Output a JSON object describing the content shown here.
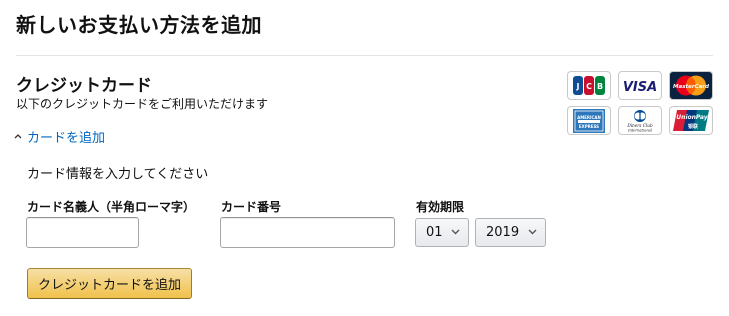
{
  "page": {
    "title": "新しいお支払い方法を追加"
  },
  "credit_card": {
    "title": "クレジットカード",
    "subtitle": "以下のクレジットカードをご利用いただけます",
    "add_link": "カードを追加",
    "brands": [
      {
        "name": "JCB",
        "icon": "jcb-icon",
        "color": "#0e4c96"
      },
      {
        "name": "VISA",
        "icon": "visa-icon",
        "color": "#1a1f71"
      },
      {
        "name": "MasterCard",
        "icon": "mastercard-icon",
        "color": "#eb001b"
      },
      {
        "name": "AMERICAN EXPRESS",
        "icon": "amex-icon",
        "color": "#2e77bb"
      },
      {
        "name": "Diners Club International",
        "icon": "diners-club-icon",
        "color": "#004a97"
      },
      {
        "name": "UnionPay 银联",
        "icon": "unionpay-icon",
        "color": "#d91e36"
      }
    ]
  },
  "form": {
    "heading": "カード情報を入力してください",
    "name_label": "カード名義人（半角ローマ字）",
    "name_value": "",
    "number_label": "カード番号",
    "number_value": "",
    "expiry_label": "有効期限",
    "expiry_month": "01",
    "expiry_year": "2019",
    "submit_label": "クレジットカードを追加"
  },
  "colors": {
    "link": "#0066c0",
    "button": "#f0c14b",
    "button_border": "#a88734"
  }
}
